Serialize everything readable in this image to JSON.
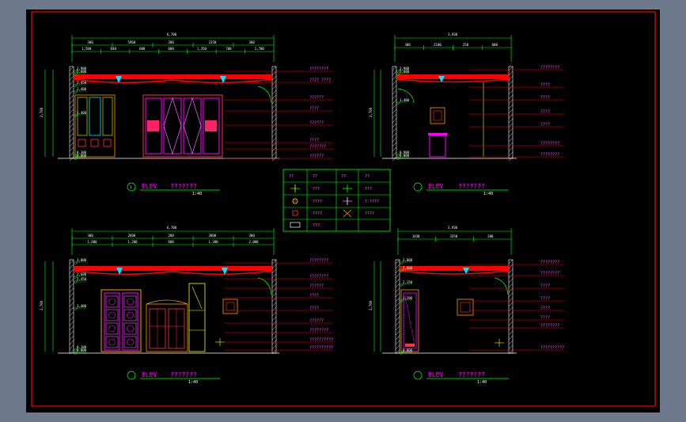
{
  "frame": {
    "border_color": "#ff0000",
    "background": "#000000"
  },
  "elevations": [
    {
      "id": "elev-1",
      "title": "ELEV",
      "name": "???????",
      "scale": "1:40",
      "overall_dim": "6,700",
      "dims_row1": [
        "300",
        "5960",
        "200",
        "2350",
        "300"
      ],
      "dims_row2": [
        "1,500",
        "640",
        "600",
        "600",
        "1,350",
        "700",
        "1,700"
      ],
      "levels": [
        "2,900",
        "2,600",
        "2,450",
        "2,400",
        "1,400",
        "0.300",
        "0.000"
      ],
      "height_dim": "2,700",
      "labels": [
        "????????",
        "???? ????",
        "??????",
        "????",
        "??????",
        "????",
        "???????",
        "??????"
      ]
    },
    {
      "id": "elev-2",
      "title": "ELEV",
      "name": "???????",
      "scale": "1:40",
      "overall_dim": "3,930",
      "dims_row1": [
        "300",
        "2100",
        "250",
        "600"
      ],
      "levels": [
        "2,900",
        "2,600",
        "1,400",
        "0.900",
        "0.000"
      ],
      "height_dim": "2,700",
      "labels": [
        "????????",
        "????",
        "????",
        "????",
        "????",
        "????????",
        "????????"
      ]
    },
    {
      "id": "elev-3",
      "title": "ELEV",
      "name": "???????",
      "scale": "1:40",
      "overall_dim": "6,700",
      "dims_row1": [
        "300",
        "2600",
        "200",
        "2000",
        "300"
      ],
      "dims_row2": [
        "1,600",
        "1,200",
        "600",
        "1,200",
        "2,000"
      ],
      "levels": [
        "3,000",
        "2,600",
        "2,450",
        "1,400",
        "0.100",
        "0.000"
      ],
      "height_dim": "2,700",
      "labels": [
        "????????",
        "????????",
        "??????",
        "????",
        "????",
        "??????",
        "????????",
        "??????????",
        "??????????"
      ]
    },
    {
      "id": "elev-4",
      "title": "ELEV",
      "name": "???????",
      "scale": "1:40",
      "overall_dim": "3,930",
      "dims_row1": [
        "1430",
        "3350",
        "200"
      ],
      "levels": [
        "3,000",
        "2,600",
        "2,150",
        "1,200",
        "0.000"
      ],
      "height_dim": "2,700",
      "labels": [
        "????????",
        "????????",
        "????",
        "????",
        "????",
        "????",
        "????????",
        "??????????"
      ]
    }
  ],
  "legend": {
    "rows": [
      [
        "??",
        "??",
        "??",
        "??"
      ],
      [
        "",
        "???",
        "",
        "???"
      ],
      [
        "",
        "????",
        "",
        "?.????"
      ],
      [
        "",
        "????",
        "",
        "????"
      ],
      [
        "",
        "???",
        "",
        ""
      ]
    ],
    "symbols": [
      "cross-icon",
      "switch-icon",
      "lamp-icon",
      "downlight-icon",
      "outlet-icon",
      "fan-icon",
      "panel-icon"
    ]
  }
}
